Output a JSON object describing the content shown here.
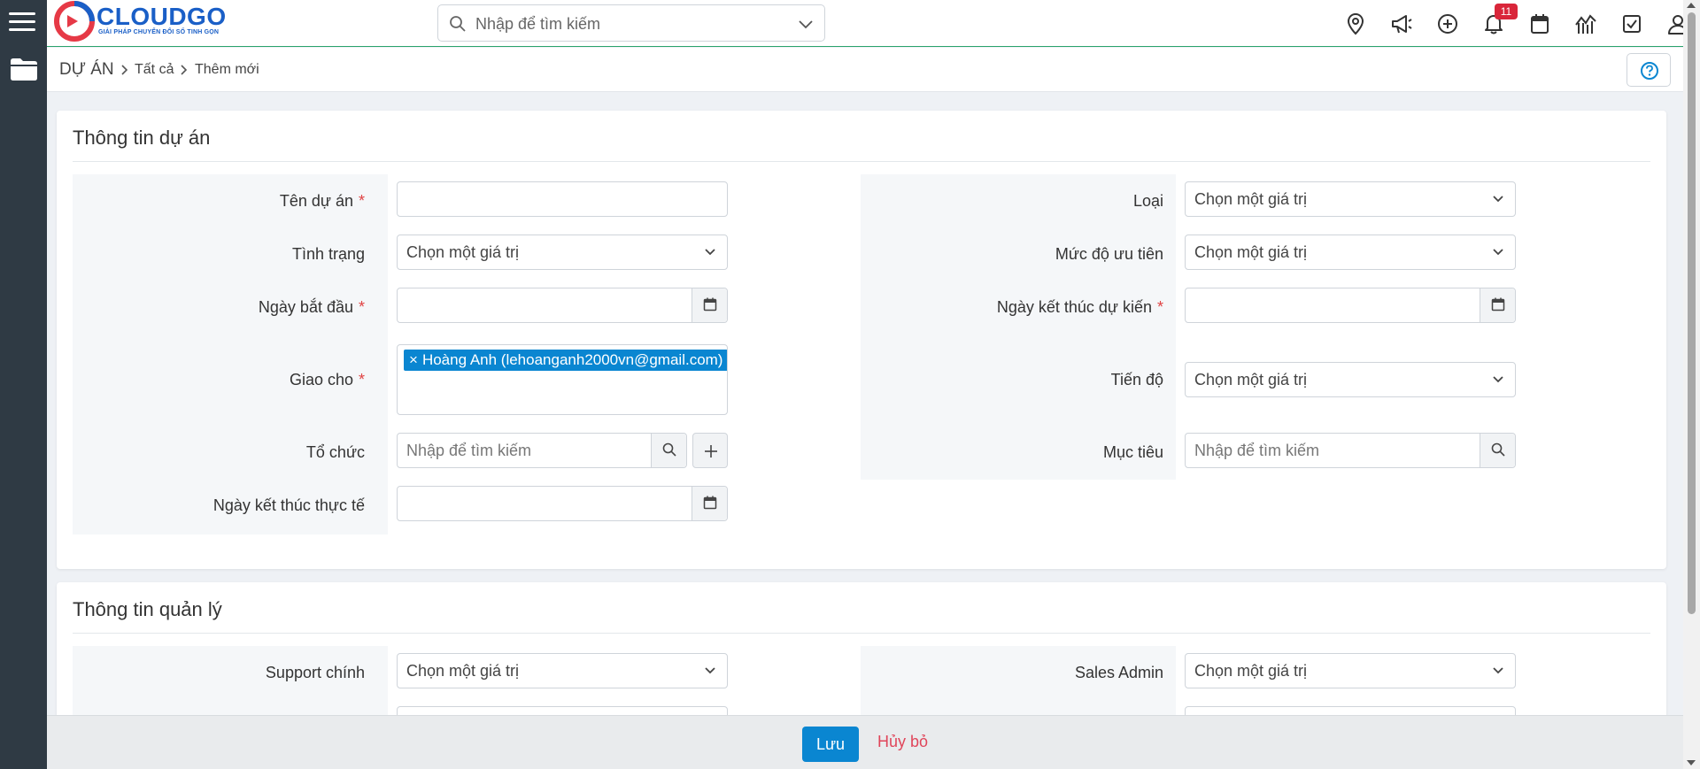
{
  "app": {
    "logo_text": "CLOUDGO",
    "logo_tagline": "GIẢI PHÁP CHUYỂN ĐỔI SỐ TINH GỌN"
  },
  "topbar": {
    "search_placeholder": "Nhập để tìm kiếm",
    "notification_count": "11",
    "icons": [
      "location-icon",
      "megaphone-icon",
      "plus-circle-icon",
      "bell-icon",
      "calendar-icon",
      "chart-icon",
      "checkbox-icon",
      "user-icon"
    ]
  },
  "breadcrumb": {
    "root": "DỰ ÁN",
    "items": [
      "Tất cả",
      "Thêm mới"
    ]
  },
  "section_project": {
    "title": "Thông tin dự án",
    "fields": {
      "name": {
        "label": "Tên dự án",
        "required": "*",
        "value": ""
      },
      "type": {
        "label": "Loại",
        "placeholder": "Chọn một giá trị"
      },
      "status": {
        "label": "Tình trạng",
        "placeholder": "Chọn một giá trị"
      },
      "priority": {
        "label": "Mức độ ưu tiên",
        "placeholder": "Chọn một giá trị"
      },
      "start_date": {
        "label": "Ngày bắt đầu",
        "required": "*",
        "value": ""
      },
      "expected_end_date": {
        "label": "Ngày kết thúc dự kiến",
        "required": "*",
        "value": ""
      },
      "assigned_to": {
        "label": "Giao cho",
        "required": "*",
        "tags": [
          "Hoàng Anh (lehoanganh2000vn@gmail.com)"
        ]
      },
      "progress": {
        "label": "Tiến độ",
        "placeholder": "Chọn một giá trị"
      },
      "organization": {
        "label": "Tổ chức",
        "placeholder": "Nhập để tìm kiếm"
      },
      "goal": {
        "label": "Mục tiêu",
        "placeholder": "Nhập để tìm kiếm"
      },
      "actual_end_date": {
        "label": "Ngày kết thúc thực tế",
        "value": ""
      }
    }
  },
  "section_management": {
    "title": "Thông tin quản lý",
    "fields": {
      "main_support": {
        "label": "Support chính",
        "placeholder": "Chọn một giá trị"
      },
      "sales_admin": {
        "label": "Sales Admin",
        "placeholder": "Chọn một giá trị"
      }
    }
  },
  "footer": {
    "save_label": "Lưu",
    "cancel_label": "Hủy bỏ"
  },
  "colors": {
    "primary": "#0a86d1",
    "rail": "#2f3a44",
    "required": "#e04343",
    "cancel": "#e0455a",
    "badge": "#d9263a"
  }
}
